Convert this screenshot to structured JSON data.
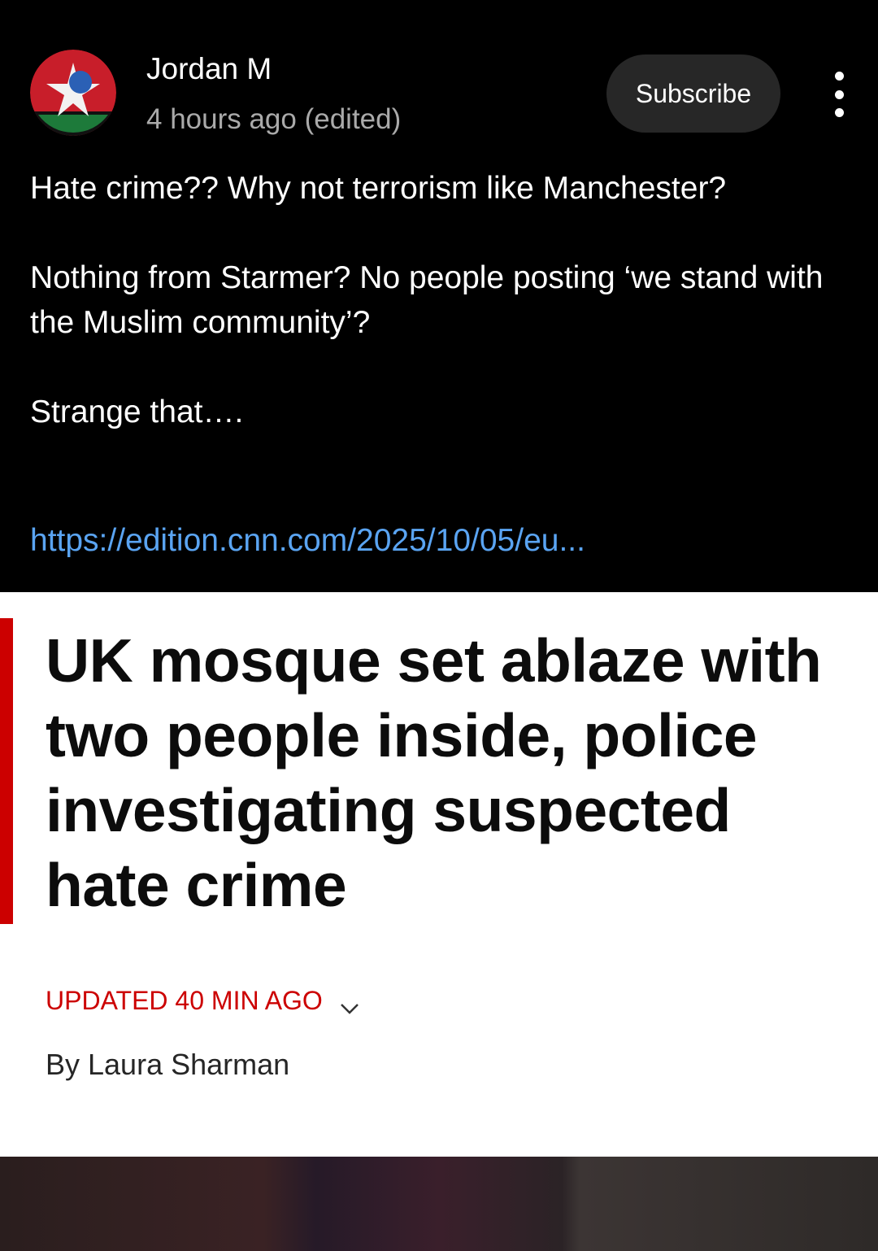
{
  "comment": {
    "author": "Jordan M",
    "timestamp": "4 hours ago (edited)",
    "subscribe_label": "Subscribe",
    "paragraph1": "Hate crime?? Why not terrorism like Manchester?",
    "paragraph2": "Nothing from Starmer? No people posting ‘we stand with the Muslim community’?",
    "paragraph3": "Strange that….",
    "link_text": "https://edition.cnn.com/2025/10/05/eu..."
  },
  "article": {
    "headline": "UK mosque set ablaze with two people inside, police investigating suspected hate crime",
    "updated": "UPDATED 40 MIN AGO",
    "byline": "By Laura Sharman"
  },
  "colors": {
    "background": "#000000",
    "subscribe_bg": "#272727",
    "link": "#5aa4f2",
    "cnn_red": "#cc0000"
  },
  "icons": {
    "more": "vertical-ellipsis",
    "chevron": "chevron-down"
  }
}
